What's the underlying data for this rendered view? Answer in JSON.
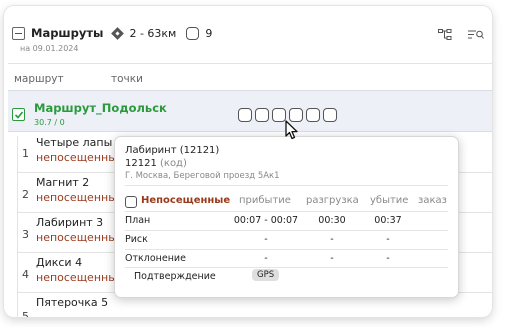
{
  "header": {
    "title": "Маршруты",
    "distance": "2 - 63км",
    "count": "9",
    "date": "на 09.01.2024"
  },
  "columns": {
    "route": "маршрут",
    "points": "точки"
  },
  "route": {
    "name": "Маршрут_Подольск",
    "sub": "30.7 / 0",
    "accent": "#2a9a3c"
  },
  "stops": [
    {
      "num": "1",
      "name": "Четыре лапы",
      "status": "непосещенные"
    },
    {
      "num": "2",
      "name": "Магнит 2",
      "status": "непосещенные"
    },
    {
      "num": "3",
      "name": "Лабиринт 3",
      "status": "непосещенные"
    },
    {
      "num": "4",
      "name": "Дикси 4",
      "status": "непосещенные"
    },
    {
      "num": "5",
      "name": "Пятерочка 5",
      "status": ""
    }
  ],
  "popup": {
    "title": "Лабиринт (12121)",
    "code": "12121",
    "code_label": "(код)",
    "address": "Г. Москва, Береговой проезд 5Ак1",
    "unvisited_label": "Непосещенные",
    "col_arrival": "прибытие",
    "col_unload": "разгрузка",
    "col_departure": "убытие",
    "col_order": "заказ",
    "rows": [
      {
        "label": "План",
        "arrival": "00:07 - 00:07",
        "unload": "00:30",
        "departure": "00:37"
      },
      {
        "label": "Риск",
        "arrival": "-",
        "unload": "-",
        "departure": "-"
      },
      {
        "label": "Отклонение",
        "arrival": "-",
        "unload": "-",
        "departure": "-"
      }
    ],
    "confirm_label": "Подтверждение",
    "gps_label": "GPS"
  },
  "icons": [
    "collapse-icon",
    "route-diamond-icon",
    "hierarchy-icon",
    "filter-search-icon",
    "cursor-arrow-icon",
    "checkmark-icon"
  ]
}
